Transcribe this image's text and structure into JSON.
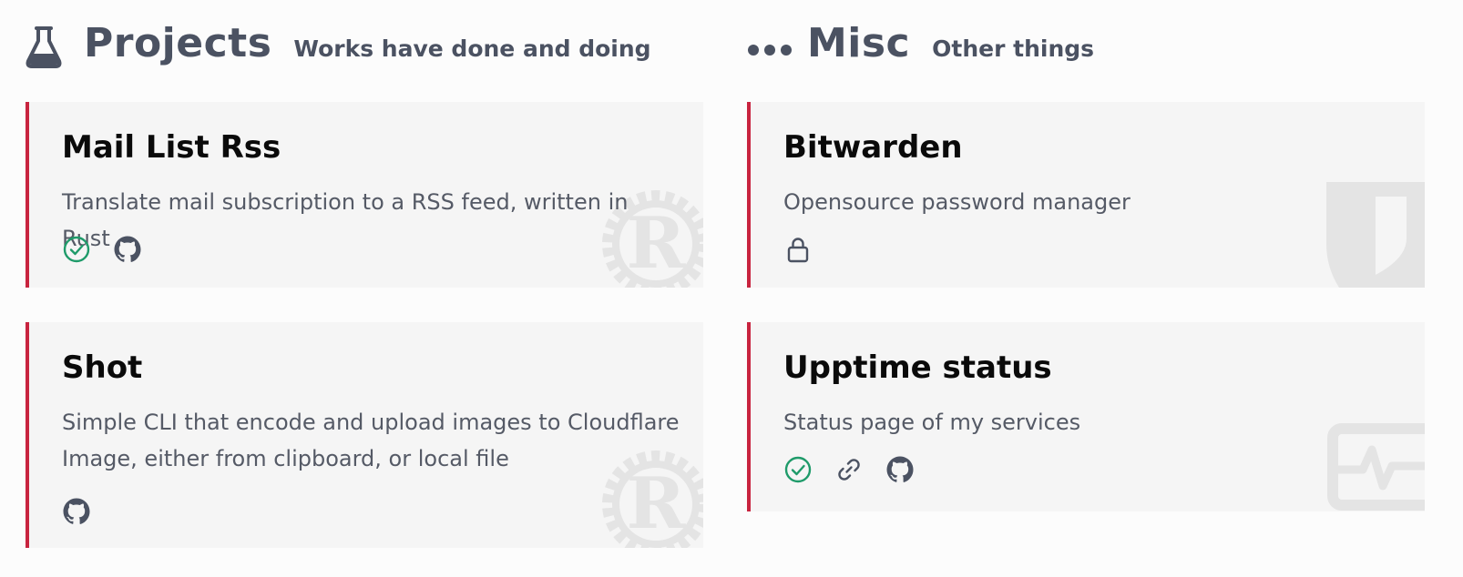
{
  "projects": {
    "title": "Projects",
    "subtitle": "Works have done and doing",
    "icon": "flask-icon",
    "cards": [
      {
        "title": "Mail List Rss",
        "description": "Translate mail subscription to a RSS feed, written in Rust",
        "watermark": "rust-logo",
        "links": [
          "check-circle-icon",
          "github-icon"
        ]
      },
      {
        "title": "Shot",
        "description": "Simple CLI that encode and upload images to Cloudflare Image, either from clipboard, or local file",
        "watermark": "rust-logo",
        "links": [
          "github-icon"
        ]
      }
    ]
  },
  "misc": {
    "title": "Misc",
    "subtitle": "Other things",
    "icon": "dots-icon",
    "cards": [
      {
        "title": "Bitwarden",
        "description": "Opensource password manager",
        "watermark": "bitwarden-shield-logo",
        "links": [
          "lock-icon"
        ]
      },
      {
        "title": "Upptime status",
        "description": "Status page of my services",
        "watermark": "activity-monitor-logo",
        "links": [
          "check-circle-icon",
          "link-icon",
          "github-icon"
        ]
      }
    ]
  },
  "colors": {
    "accent": "#c8243f",
    "heading": "#4b5262",
    "success": "#1f9b6a",
    "card_bg": "#f5f5f5"
  }
}
